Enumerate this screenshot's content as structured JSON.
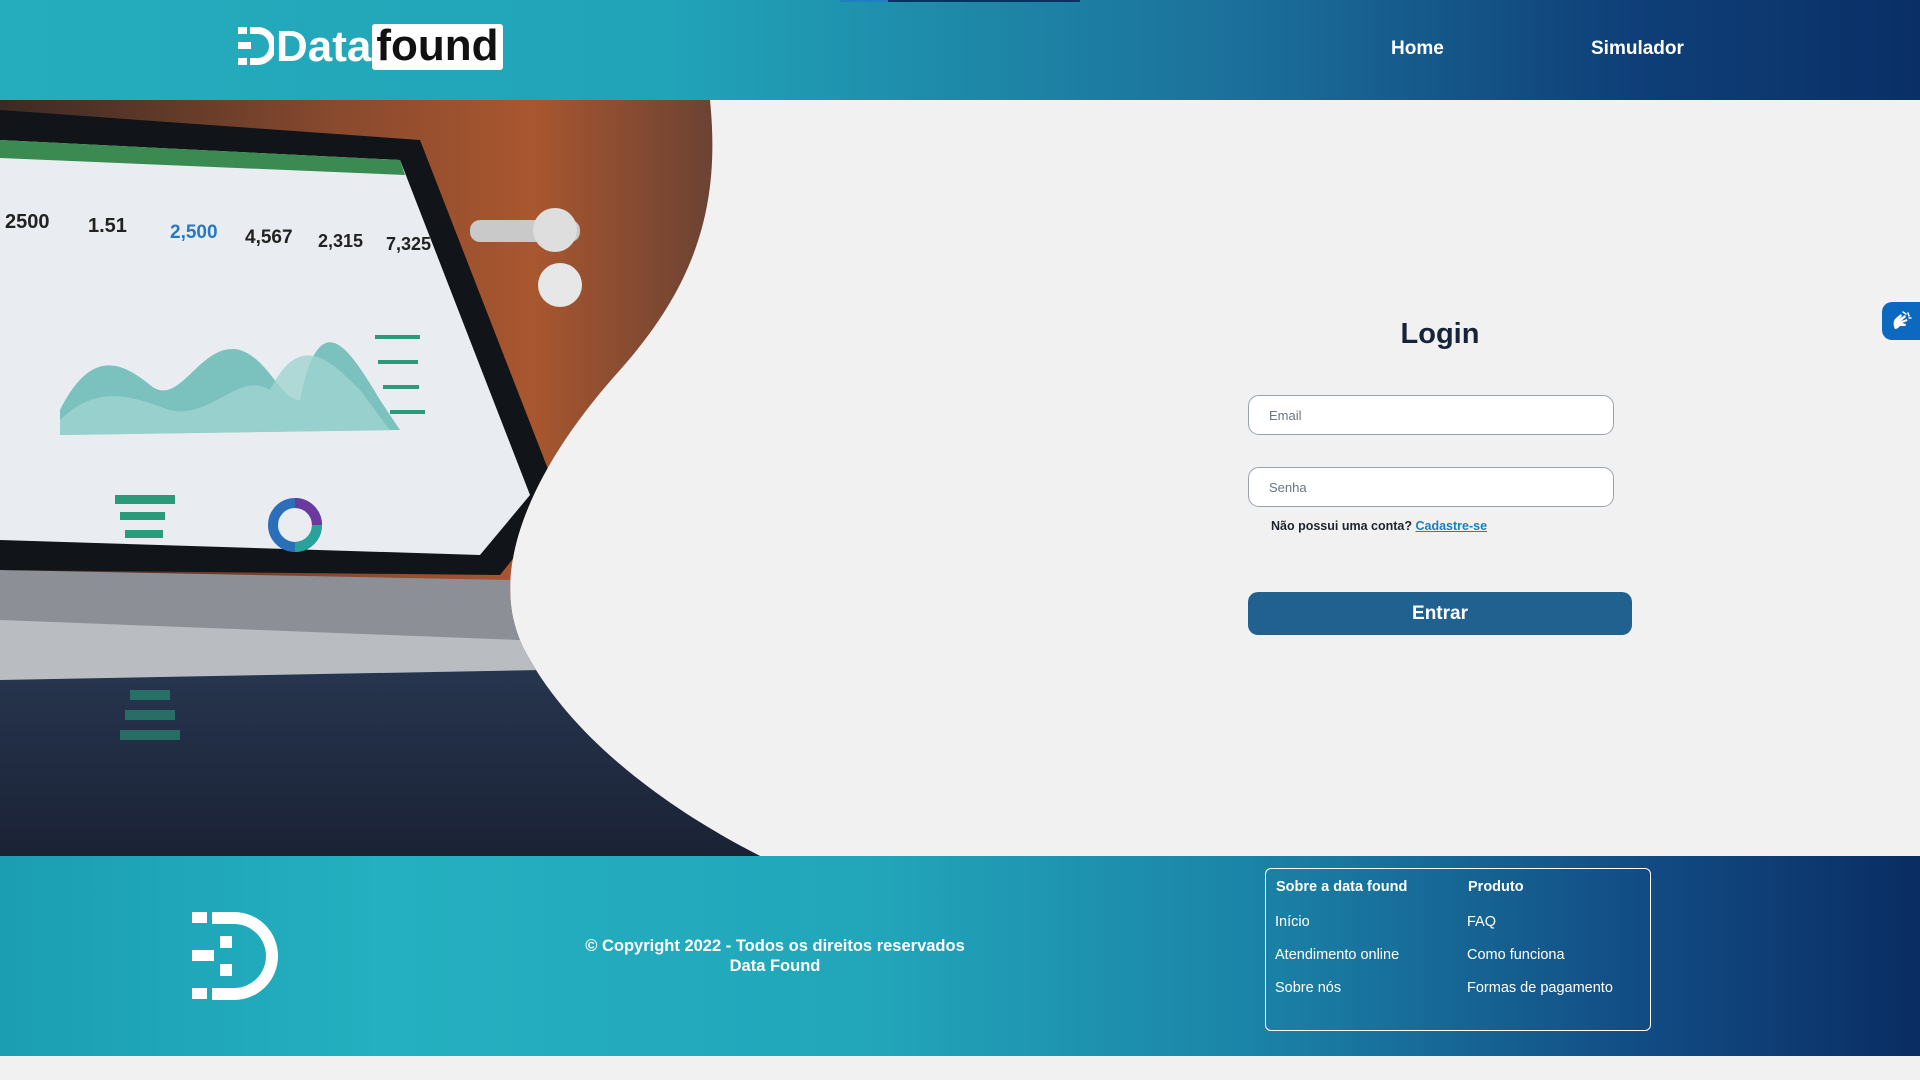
{
  "header": {
    "logo_part1": "Data",
    "logo_part2": "found",
    "nav": [
      {
        "label": "Home"
      },
      {
        "label": "Simulador"
      }
    ]
  },
  "hero": {
    "dashboard_numbers": [
      "2500",
      "1.51",
      "2,500",
      "4,567",
      "2,315",
      "7,325"
    ]
  },
  "login": {
    "title": "Login",
    "email_placeholder": "Email",
    "password_placeholder": "Senha",
    "signup_prompt": "Não possui uma conta?",
    "signup_link": "Cadastre-se",
    "submit_label": "Entrar"
  },
  "accessibility": {
    "icon": "sign-language-hands-icon"
  },
  "footer": {
    "copyright_line1": "© Copyright 2022 - Todos os direitos reservados",
    "copyright_line2": "Data Found",
    "columns": [
      {
        "heading": "Sobre a data found",
        "items": [
          "Início",
          "Atendimento online",
          "Sobre nós"
        ]
      },
      {
        "heading": "Produto",
        "items": [
          "FAQ",
          "Como funciona",
          "Formas de pagamento"
        ]
      }
    ]
  },
  "colors": {
    "header_start": "#25adbd",
    "header_end": "#0a2f66",
    "button": "#21618f",
    "link": "#1f7fb8",
    "accessibility": "#0d68c0",
    "page_background": "#f1f1f1"
  }
}
